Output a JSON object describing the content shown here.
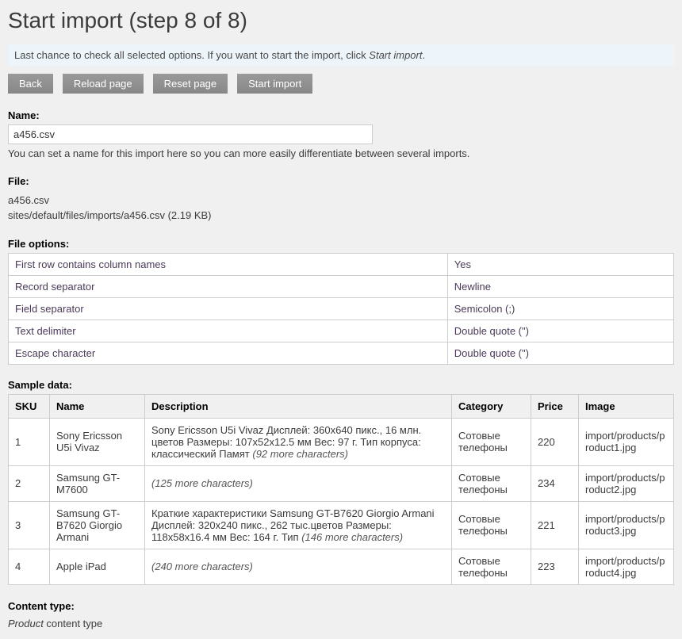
{
  "page_title": "Start import (step 8 of 8)",
  "info_text_pre": "Last chance to check all selected options. If you want to start the import, click ",
  "info_text_em": "Start import",
  "info_text_post": ".",
  "buttons": {
    "back": "Back",
    "reload": "Reload page",
    "reset": "Reset page",
    "start": "Start import"
  },
  "name": {
    "label": "Name:",
    "value": "a456.csv",
    "help": "You can set a name for this import here so you can more easily differentiate between several imports."
  },
  "file": {
    "label": "File:",
    "filename": "a456.csv",
    "path": "sites/default/files/imports/a456.csv (2.19 KB)"
  },
  "file_options": {
    "label": "File options:",
    "rows": [
      {
        "k": "First row contains column names",
        "v": "Yes"
      },
      {
        "k": "Record separator",
        "v": "Newline"
      },
      {
        "k": "Field separator",
        "v": "Semicolon (;)"
      },
      {
        "k": "Text delimiter",
        "v": "Double quote (\")"
      },
      {
        "k": "Escape character",
        "v": "Double quote (\")"
      }
    ]
  },
  "sample": {
    "label": "Sample data:",
    "headers": {
      "sku": "SKU",
      "name": "Name",
      "description": "Description",
      "category": "Category",
      "price": "Price",
      "image": "Image"
    },
    "rows": [
      {
        "sku": "1",
        "name": "Sony Ericsson U5i Vivaz",
        "desc": "Sony Ericsson U5i Vivaz Дисплей: 360x640 пикс., 16 млн. цветов Размеры: 107x52x12.5 мм Вес: 97 г. Тип корпуса: классический Памят ",
        "desc_more": "(92 more characters)",
        "category": "Сотовые телефоны",
        "price": "220",
        "image": "import/products/product1.jpg"
      },
      {
        "sku": "2",
        "name": "Samsung GT-M7600",
        "desc": "",
        "desc_more": "(125 more characters)",
        "category": "Сотовые телефоны",
        "price": "234",
        "image": "import/products/product2.jpg"
      },
      {
        "sku": "3",
        "name": "Samsung GT-B7620 Giorgio Armani",
        "desc": "Краткие характеристики Samsung GT-B7620 Giorgio Armani Дисплей: 320x240 пикс., 262 тыс.цветов Размеры: 118x58x16.4 мм Вес: 164 г. Тип ",
        "desc_more": "(146 more characters)",
        "category": "Сотовые телефоны",
        "price": "221",
        "image": "import/products/product3.jpg"
      },
      {
        "sku": "4",
        "name": "Apple iPad",
        "desc": "",
        "desc_more": "(240 more characters)",
        "category": "Сотовые телефоны",
        "price": "223",
        "image": "import/products/product4.jpg"
      }
    ]
  },
  "content_type": {
    "label": "Content type:",
    "value_em": "Product",
    "value_post": " content type"
  }
}
